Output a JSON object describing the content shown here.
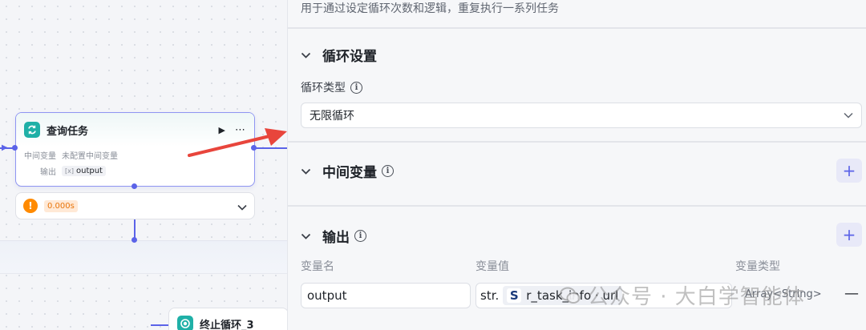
{
  "canvas": {
    "query_node": {
      "title": "查询任务",
      "inter_var_label": "中间变量",
      "inter_var_value": "未配置中间变量",
      "output_label": "输出",
      "output_var_icon": "[x]",
      "output_var": "output"
    },
    "status": {
      "time": "0.000s"
    },
    "stop_node": {
      "title": "终止循环_3"
    }
  },
  "panel": {
    "description": "用于通过设定循环次数和逻辑，重复执行一系列任务",
    "loop_settings": {
      "title": "循环设置",
      "loop_type_label": "循环类型",
      "loop_type_value": "无限循环"
    },
    "intermediate_vars": {
      "title": "中间变量"
    },
    "output": {
      "title": "输出",
      "col_name": "变量名",
      "col_value": "变量值",
      "col_type": "变量类型",
      "row": {
        "name": "output",
        "value_type_prefix": "str.",
        "ref_badge": "S",
        "ref_value": "r_task_info · url",
        "var_type": "Array<String>"
      }
    },
    "watermark": "公众号 · 大白学智能体"
  },
  "colors": {
    "accent": "#5b63e8",
    "node_icon": "#1fb0a7",
    "warning": "#ff8a00",
    "annotation": "#e8453c"
  }
}
